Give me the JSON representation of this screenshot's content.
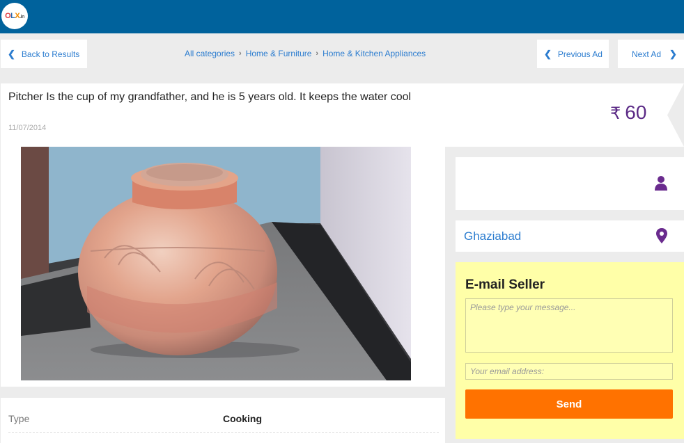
{
  "header": {
    "logo_text": "OLX.in",
    "logo_parts": [
      "O",
      "L",
      "X",
      ".in"
    ]
  },
  "nav": {
    "back_label": "Back to Results",
    "previous_label": "Previous Ad",
    "next_label": "Next Ad"
  },
  "breadcrumb": [
    "All categories",
    "Home & Furniture",
    "Home & Kitchen Appliances"
  ],
  "ad": {
    "title": "Pitcher Is the cup of my grandfather, and he is 5 years old. It keeps the water cool",
    "date": "11/07/2014",
    "currency_symbol": "₹",
    "price": "60"
  },
  "details": {
    "type_label": "Type",
    "type_value": "Cooking"
  },
  "seller": {
    "location": "Ghaziabad"
  },
  "email_form": {
    "title": "E-mail Seller",
    "message_placeholder": "Please type your message...",
    "email_placeholder": "Your email address:",
    "send_label": "Send"
  },
  "icons": {
    "back": "chevron-left-icon",
    "previous": "chevron-left-icon",
    "next": "chevron-right-icon",
    "user": "user-icon",
    "location": "map-pin-icon"
  },
  "colors": {
    "header_bg": "#00629c",
    "link": "#2b7ccf",
    "price": "#5b2a86",
    "icon_purple": "#6a2b8e",
    "mail_bg": "#ffffa8",
    "send_bg": "#ff7200"
  }
}
